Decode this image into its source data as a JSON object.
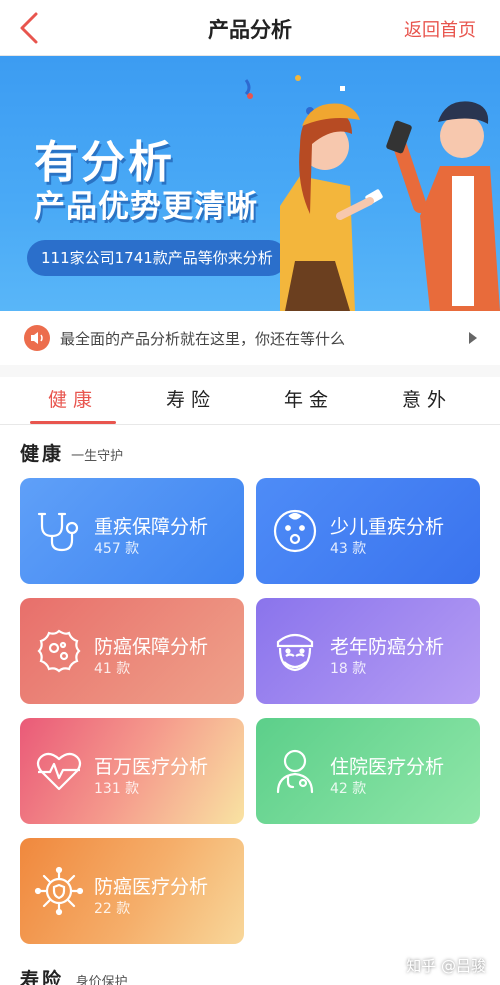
{
  "nav": {
    "title": "产品分析",
    "home_label": "返回首页"
  },
  "banner": {
    "title_line1": "有分析",
    "title_line2": "产品优势更清晰",
    "pill_text": "111家公司1741款产品等你来分析"
  },
  "notice": {
    "text": "最全面的产品分析就在这里，你还在等什么"
  },
  "tabs": [
    {
      "label": "健康",
      "active": true
    },
    {
      "label": "寿险",
      "active": false
    },
    {
      "label": "年金",
      "active": false
    },
    {
      "label": "意外",
      "active": false
    }
  ],
  "section": {
    "title": "健康",
    "subtitle": "一生守护"
  },
  "cards": [
    {
      "name": "重疾保障分析",
      "count": "457 款",
      "icon": "stethoscope-icon"
    },
    {
      "name": "少儿重疾分析",
      "count": "43 款",
      "icon": "baby-icon"
    },
    {
      "name": "防癌保障分析",
      "count": "41 款",
      "icon": "cell-icon"
    },
    {
      "name": "老年防癌分析",
      "count": "18 款",
      "icon": "elder-icon"
    },
    {
      "name": "百万医疗分析",
      "count": "131 款",
      "icon": "heartbeat-icon"
    },
    {
      "name": "住院医疗分析",
      "count": "42 款",
      "icon": "doctor-icon"
    },
    {
      "name": "防癌医疗分析",
      "count": "22 款",
      "icon": "virus-shield-icon"
    }
  ],
  "next_section": {
    "title": "寿险",
    "subtitle": "身价保护"
  },
  "watermark": "知乎 @吕骏",
  "colors": {
    "accent": "#e8554e",
    "banner_blue": "#3c9cf2"
  }
}
